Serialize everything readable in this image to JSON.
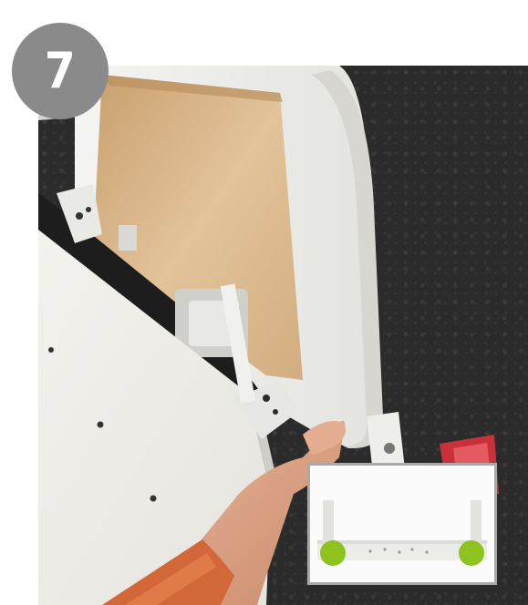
{
  "step": {
    "number": "7",
    "badge_color": "#8a8a8a"
  },
  "photo": {
    "subject": "assembly-step-photo"
  },
  "inset": {
    "marker_color": "#8dc21f",
    "markers": 2
  }
}
